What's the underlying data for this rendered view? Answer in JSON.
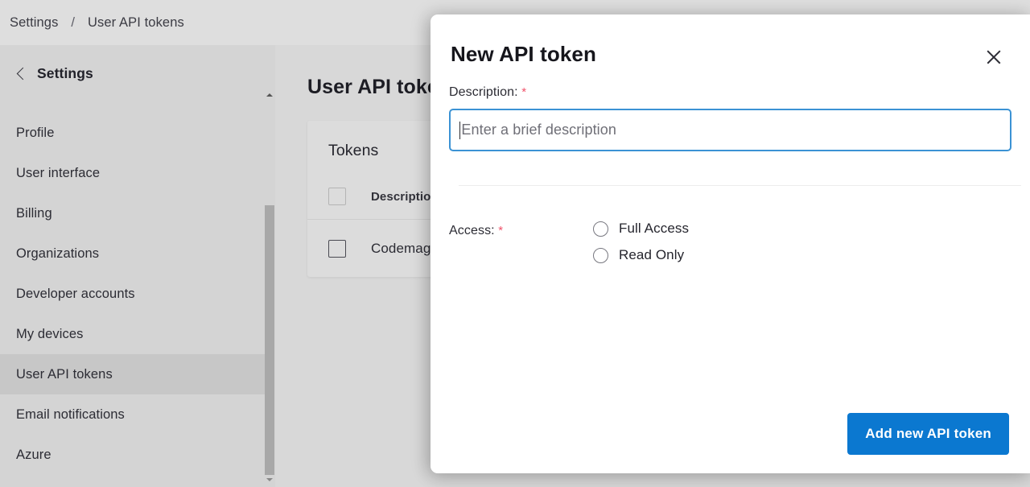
{
  "breadcrumb": {
    "root": "Settings",
    "separator": "/",
    "current": "User API tokens"
  },
  "sidebar": {
    "back_label": "Settings",
    "back_icon": "chevron-left-icon",
    "items": [
      {
        "label": "Profile",
        "active": false
      },
      {
        "label": "User interface",
        "active": false
      },
      {
        "label": "Billing",
        "active": false
      },
      {
        "label": "Organizations",
        "active": false
      },
      {
        "label": "Developer accounts",
        "active": false
      },
      {
        "label": "My devices",
        "active": false
      },
      {
        "label": "User API tokens",
        "active": true
      },
      {
        "label": "Email notifications",
        "active": false
      },
      {
        "label": "Azure",
        "active": false
      }
    ],
    "scrollbar": {
      "up_icon": "scroll-up-arrow-icon",
      "down_icon": "scroll-down-arrow-icon"
    }
  },
  "main": {
    "page_title": "User API tokens",
    "card": {
      "title": "Tokens",
      "columns": [
        "Description"
      ],
      "rows": [
        {
          "description": "Codemagic"
        }
      ]
    }
  },
  "modal": {
    "title": "New API token",
    "close_icon": "close-icon",
    "description": {
      "label": "Description:",
      "required_mark": "*",
      "placeholder": "Enter a brief description",
      "value": ""
    },
    "access": {
      "label": "Access:",
      "required_mark": "*",
      "options": [
        {
          "label": "Full Access",
          "selected": false
        },
        {
          "label": "Read Only",
          "selected": false
        }
      ]
    },
    "submit_label": "Add new API token"
  },
  "colors": {
    "accent_blue": "#0b78d0",
    "focus_border": "#3b92d4",
    "required_red": "#f0536b",
    "brand_teal": "#7fd0e8",
    "sidebar_bg": "#d4d4d4",
    "content_bg": "#d8d8d8"
  }
}
